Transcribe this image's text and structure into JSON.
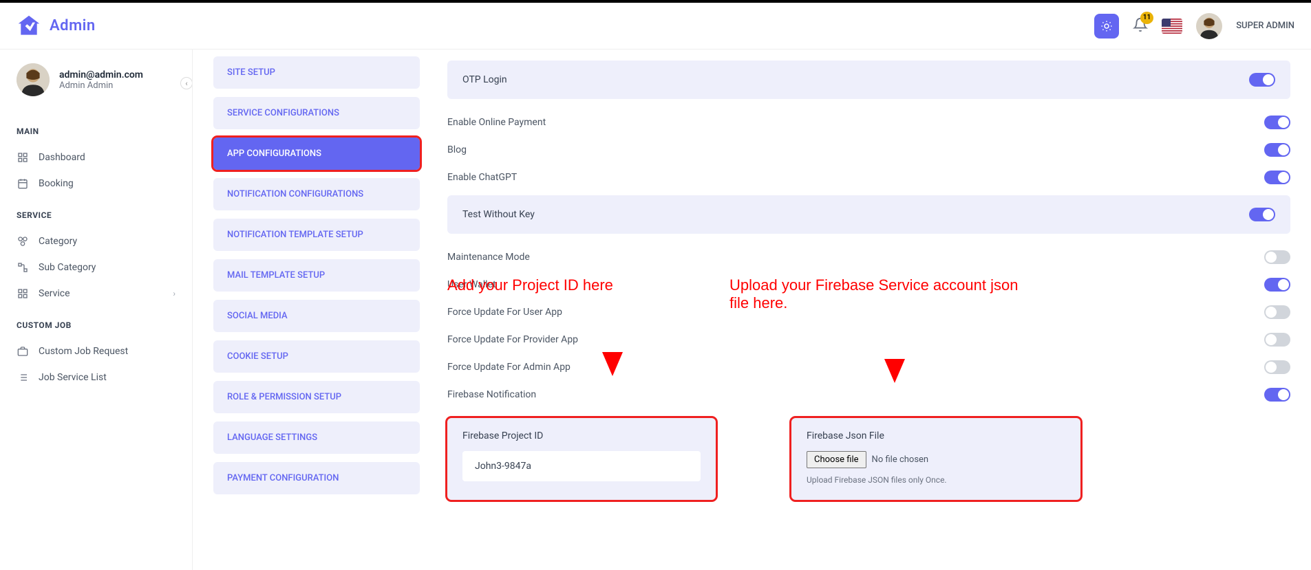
{
  "header": {
    "app_title": "Admin",
    "notif_count": "11",
    "user_label": "SUPER ADMIN"
  },
  "sidebar": {
    "user_email": "admin@admin.com",
    "user_name": "Admin Admin",
    "sections": {
      "main": "MAIN",
      "service": "SERVICE",
      "custom_job": "CUSTOM JOB"
    },
    "items": {
      "dashboard": "Dashboard",
      "booking": "Booking",
      "category": "Category",
      "sub_category": "Sub Category",
      "service": "Service",
      "custom_job_request": "Custom Job Request",
      "job_service_list": "Job Service List"
    }
  },
  "settings_nav": {
    "site_setup": "SITE SETUP",
    "service_config": "SERVICE CONFIGURATIONS",
    "app_config": "APP CONFIGURATIONS",
    "notif_config": "NOTIFICATION CONFIGURATIONS",
    "notif_template": "NOTIFICATION TEMPLATE SETUP",
    "mail_template": "MAIL TEMPLATE SETUP",
    "social_media": "SOCIAL MEDIA",
    "cookie_setup": "COOKIE SETUP",
    "role_permission": "ROLE & PERMISSION SETUP",
    "language_settings": "LANGUAGE SETTINGS",
    "payment_config": "PAYMENT CONFIGURATION"
  },
  "toggles": {
    "otp_login": "OTP Login",
    "online_payment": "Enable Online Payment",
    "blog": "Blog",
    "chatgpt": "Enable ChatGPT",
    "test_no_key": "Test Without Key",
    "maintenance": "Maintenance Mode",
    "user_wallet": "User Wallet",
    "force_user": "Force Update For User App",
    "force_provider": "Force Update For Provider App",
    "force_admin": "Force Update For Admin App",
    "firebase_notif": "Firebase Notification"
  },
  "annotations": {
    "project_id": "Add your Project ID here",
    "json_file": "Upload your Firebase Service account json file here."
  },
  "firebase": {
    "project_id_label": "Firebase Project ID",
    "project_id_value": "John3-9847a",
    "json_label": "Firebase Json File",
    "choose_file": "Choose file",
    "no_file": "No file chosen",
    "hint": "Upload Firebase JSON files only Once."
  }
}
